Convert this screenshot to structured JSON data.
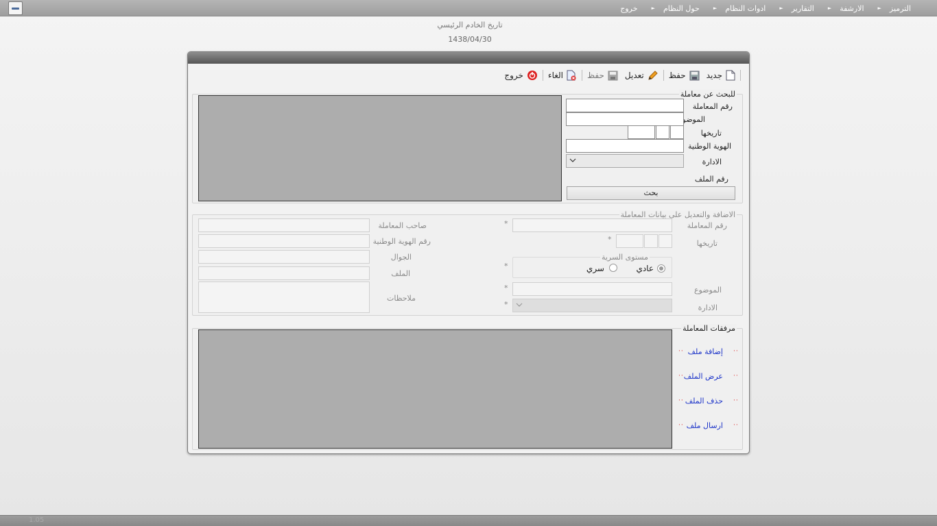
{
  "menubar": {
    "items": [
      {
        "label": "الترميز"
      },
      {
        "label": "الارشفة"
      },
      {
        "label": "التقارير"
      },
      {
        "label": "ادوات النظام"
      },
      {
        "label": "حول النظام"
      },
      {
        "label": "خروج"
      }
    ]
  },
  "server_date": {
    "label": "تاريخ الخادم الرئيسي",
    "value": "1438/04/30"
  },
  "toolbar": {
    "new": "جديد",
    "save": "حفظ",
    "edit": "تعديل",
    "save2": "حفظ",
    "cancel": "الغاء",
    "exit": "خروج"
  },
  "search": {
    "legend": "للبحث عن معاملة",
    "transaction_number": "رقم المعاملة",
    "subject": "الموضوع",
    "date": "تاريخها",
    "national_id": "الهوية الوطنية",
    "department": "الادارة",
    "file_number": "رقم الملف",
    "search_button": "بحث"
  },
  "edit": {
    "legend": "الاضافة والتعديل على بيانات المعاملة",
    "transaction_number": "رقم المعاملة",
    "date": "تاريخها",
    "confidentiality_legend": "مستوى السرية",
    "normal": "عادي",
    "secret": "سري",
    "subject": "الموضوع",
    "department": "الادارة",
    "owner": "صاحب المعاملة",
    "national_id": "رقم الهوية الوطنية",
    "mobile": "الجوال",
    "file": "الملف",
    "notes": "ملاحظات",
    "required_mark": "*"
  },
  "attachments": {
    "legend": "مرفقات المعاملة",
    "add": "إضافة ملف",
    "view": "عرض الملف",
    "delete": "حذف الملف",
    "send": "ارسال ملف",
    "bullet": "··"
  },
  "status": {
    "version": "1.05"
  },
  "colors": {
    "link": "#1a32c8",
    "bullet": "#dd2222",
    "grid": "#adadad"
  }
}
